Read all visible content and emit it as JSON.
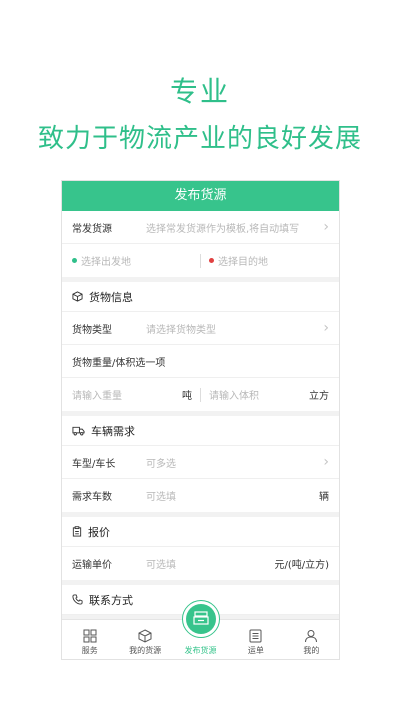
{
  "hero": {
    "line1": "专业",
    "line2": "致力于物流产业的良好发展"
  },
  "header": {
    "title": "发布货源"
  },
  "colors": {
    "accent": "#37c48c",
    "origin_dot": "#2fbf8a",
    "dest_dot": "#e04040"
  },
  "source": {
    "common_label": "常发货源",
    "common_placeholder": "选择常发货源作为模板,将自动填写",
    "origin_placeholder": "选择出发地",
    "dest_placeholder": "选择目的地"
  },
  "cargo": {
    "title": "货物信息",
    "type_label": "货物类型",
    "type_placeholder": "请选择货物类型",
    "weight_volume_label": "货物重量/体积选一项",
    "weight_placeholder": "请输入重量",
    "weight_unit": "吨",
    "volume_placeholder": "请输入体积",
    "volume_unit": "立方"
  },
  "vehicle": {
    "title": "车辆需求",
    "model_label": "车型/车长",
    "model_placeholder": "可多选",
    "count_label": "需求车数",
    "count_placeholder": "可选填",
    "count_unit": "辆"
  },
  "price": {
    "title": "报价",
    "unit_price_label": "运输单价",
    "unit_price_placeholder": "可选填",
    "unit_price_unit": "元/(吨/立方)"
  },
  "contact": {
    "title": "联系方式"
  },
  "tabs": [
    {
      "label": "服务",
      "icon": "grid-icon"
    },
    {
      "label": "我的货源",
      "icon": "box-icon"
    },
    {
      "label": "发布货源",
      "icon": "publish-icon"
    },
    {
      "label": "运单",
      "icon": "list-icon"
    },
    {
      "label": "我的",
      "icon": "user-icon"
    }
  ]
}
